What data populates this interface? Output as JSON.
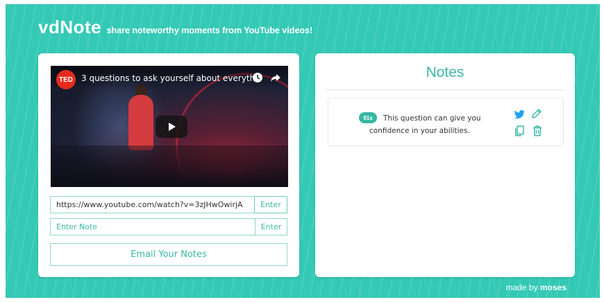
{
  "brand": {
    "logo": "vdNote",
    "tagline": "share noteworthy moments from YouTube videos!"
  },
  "player": {
    "channel_badge": "TED",
    "video_title": "3 questions to ask yourself about everythi...",
    "icons": [
      "watch-later-icon",
      "share-icon",
      "play-icon"
    ]
  },
  "url_form": {
    "value": "https://www.youtube.com/watch?v=3zJHwOwirjA",
    "button_label": "Enter"
  },
  "note_form": {
    "placeholder": "Enter Note",
    "button_label": "Enter"
  },
  "email_button": "Email Your Notes",
  "notes": {
    "title": "Notes",
    "items": [
      {
        "timestamp": "91s",
        "text": "This question can give you confidence in your abilities."
      }
    ],
    "action_icons": [
      "twitter-icon",
      "pencil-icon",
      "copy-icon",
      "trash-icon"
    ]
  },
  "footer": {
    "prefix": "made by",
    "author": "moses"
  },
  "colors": {
    "background": "#33c9b5",
    "accent": "#3bb8a6",
    "badge": "#37b7a1",
    "ted_red": "#e62b1e",
    "twitter_blue": "#1da1f2"
  }
}
